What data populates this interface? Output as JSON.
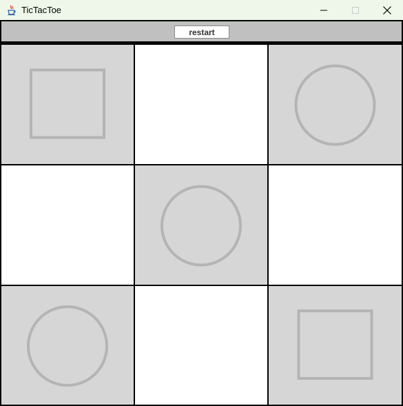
{
  "window": {
    "title": "TicTacToe",
    "icon": "java-cup-icon"
  },
  "toolbar": {
    "restart_label": "restart"
  },
  "colors": {
    "filled_cell": "#d6d6d6",
    "empty_cell": "#ffffff",
    "mark": "#b4b4b4",
    "grid_line": "#000000",
    "toolbar": "#c0c0c0",
    "titlebar": "#eef7e9"
  },
  "board": {
    "rows": 3,
    "cols": 3,
    "cells": [
      "square",
      "",
      "circle",
      "",
      "circle",
      "",
      "circle",
      "",
      "square"
    ]
  }
}
